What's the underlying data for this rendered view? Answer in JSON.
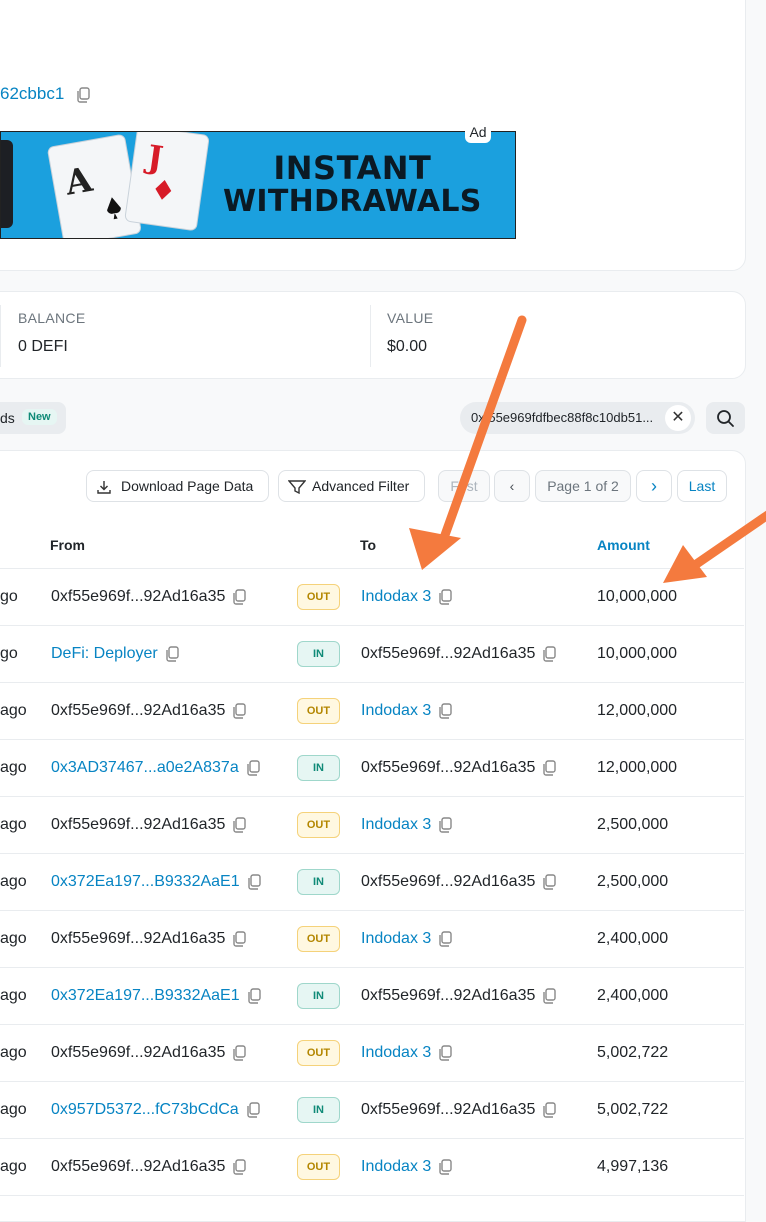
{
  "address_fragment": "62cbbc1",
  "ad": {
    "badge": "Ad",
    "line1": "INSTANT",
    "line2": "WITHDRAWALS",
    "card1": "A",
    "card2": "J"
  },
  "overview": {
    "balance_label": "BALANCE",
    "balance_value": "0 DEFI",
    "value_label": "VALUE",
    "value_value": "$0.00"
  },
  "tabs": {
    "partial_label": "ds",
    "new_badge": "New"
  },
  "filter": {
    "address_text": "0xf55e969fdfbec88f8c10db51..."
  },
  "toolbar": {
    "download": "Download Page Data",
    "advanced_filter": "Advanced Filter",
    "first": "First",
    "page": "Page 1 of 2",
    "last": "Last"
  },
  "table": {
    "headers": {
      "from": "From",
      "to": "To",
      "amount": "Amount"
    },
    "rows": [
      {
        "age": "go",
        "from": "0xf55e969f...92Ad16a35",
        "from_link": false,
        "dir": "OUT",
        "to": "Indodax 3",
        "to_link": true,
        "amount": "10,000,000"
      },
      {
        "age": "go",
        "from": "DeFi: Deployer",
        "from_link": true,
        "dir": "IN",
        "to": "0xf55e969f...92Ad16a35",
        "to_link": false,
        "amount": "10,000,000"
      },
      {
        "age": "ago",
        "from": "0xf55e969f...92Ad16a35",
        "from_link": false,
        "dir": "OUT",
        "to": "Indodax 3",
        "to_link": true,
        "amount": "12,000,000"
      },
      {
        "age": "ago",
        "from": "0x3AD37467...a0e2A837a",
        "from_link": true,
        "dir": "IN",
        "to": "0xf55e969f...92Ad16a35",
        "to_link": false,
        "amount": "12,000,000"
      },
      {
        "age": "ago",
        "from": "0xf55e969f...92Ad16a35",
        "from_link": false,
        "dir": "OUT",
        "to": "Indodax 3",
        "to_link": true,
        "amount": "2,500,000"
      },
      {
        "age": "ago",
        "from": "0x372Ea197...B9332AaE1",
        "from_link": true,
        "dir": "IN",
        "to": "0xf55e969f...92Ad16a35",
        "to_link": false,
        "amount": "2,500,000"
      },
      {
        "age": "ago",
        "from": "0xf55e969f...92Ad16a35",
        "from_link": false,
        "dir": "OUT",
        "to": "Indodax 3",
        "to_link": true,
        "amount": "2,400,000"
      },
      {
        "age": "ago",
        "from": "0x372Ea197...B9332AaE1",
        "from_link": true,
        "dir": "IN",
        "to": "0xf55e969f...92Ad16a35",
        "to_link": false,
        "amount": "2,400,000"
      },
      {
        "age": "ago",
        "from": "0xf55e969f...92Ad16a35",
        "from_link": false,
        "dir": "OUT",
        "to": "Indodax 3",
        "to_link": true,
        "amount": "5,002,722"
      },
      {
        "age": "ago",
        "from": "0x957D5372...fC73bCdCa",
        "from_link": true,
        "dir": "IN",
        "to": "0xf55e969f...92Ad16a35",
        "to_link": false,
        "amount": "5,002,722"
      },
      {
        "age": "ago",
        "from": "0xf55e969f...92Ad16a35",
        "from_link": false,
        "dir": "OUT",
        "to": "Indodax 3",
        "to_link": true,
        "amount": "4,997,136"
      }
    ]
  },
  "colors": {
    "link": "#0784c3",
    "annotation_arrow": "#f47a3e",
    "ad_background": "#1ba0de"
  },
  "icons": [
    "copy-icon",
    "download-icon",
    "filter-icon",
    "search-icon",
    "close-icon",
    "chevron-left-icon",
    "chevron-right-icon",
    "annotation-arrow"
  ]
}
